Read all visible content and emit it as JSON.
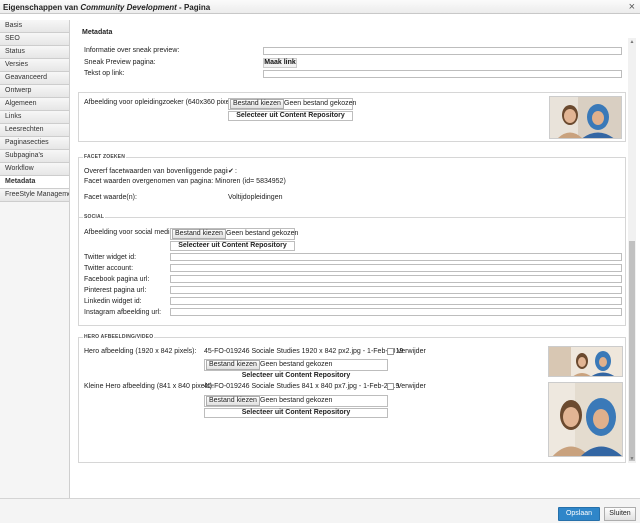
{
  "window": {
    "title_prefix": "Eigenschappen van ",
    "title_name": "Community Development",
    "title_suffix": " - Pagina",
    "close_glyph": "×"
  },
  "sidebar": {
    "items": [
      {
        "label": "Basis"
      },
      {
        "label": "SEO"
      },
      {
        "label": "Status"
      },
      {
        "label": "Versies"
      },
      {
        "label": "Geavanceerd"
      },
      {
        "label": "Ontwerp"
      },
      {
        "label": "Algemeen"
      },
      {
        "label": "Links"
      },
      {
        "label": "Leesrechten"
      },
      {
        "label": "Paginasecties"
      },
      {
        "label": "Subpagina's"
      },
      {
        "label": "Workflow"
      },
      {
        "label": "Metadata"
      },
      {
        "label": "FreeStyle Management"
      }
    ],
    "active": "Metadata"
  },
  "metadata": {
    "title": "Metadata",
    "sneak_preview_info_label": "Informatie over sneak preview:",
    "sneak_preview_page_label": "Sneak Preview pagina:",
    "make_link_label": "Maak link",
    "link_text_label": "Tekst op link:",
    "training_image_label": "Afbeelding voor opleidingzoeker (640x360 pixels):"
  },
  "file": {
    "choose_label": "Bestand kiezen",
    "no_file_label": "Geen bestand gekozen",
    "repository_label": "Selecteer uit Content Repository",
    "remove_label": "Verwijder"
  },
  "facet": {
    "legend": "FACET ZOEKEN",
    "inherit_label": "Overerf facetwaarden van bovenliggende pagina:",
    "inherit_checked": true,
    "check_glyph": "✔",
    "taken_over_label": "Facet waarden overgenomen van pagina: Minoren (id= 5834952)",
    "value_label": "Facet waarde(n):",
    "value": "Voltijdopleidingen"
  },
  "social": {
    "legend": "SOCIAL",
    "image_label": "Afbeelding voor social media:",
    "twitter_widget_label": "Twitter widget id:",
    "twitter_account_label": "Twitter account:",
    "facebook_label": "Facebook pagina url:",
    "pinterest_label": "Pinterest pagina url:",
    "linkedin_label": "Linkedin widget id:",
    "instagram_label": "Instagram afbeelding url:"
  },
  "hero": {
    "legend": "HERO AFBEELDING/VIDEO",
    "hero_label": "Hero afbeelding (1920 x 842 pixels):",
    "hero_file": "45-FO-019246 Sociale Studies 1920 x 842 px2.jpg - 1-Feb-2019",
    "small_label": "Kleine Hero afbeelding (841 x 840 pixels):",
    "small_file": "45-FO-019246 Sociale Studies 841 x 840 px7.jpg - 1-Feb-2019"
  },
  "footer": {
    "save_label": "Opslaan",
    "close_label": "Sluiten"
  },
  "scrollbar": {
    "up_glyph": "▲",
    "down_glyph": "▼"
  },
  "colors": {
    "primary_button": "#2f86c9"
  }
}
